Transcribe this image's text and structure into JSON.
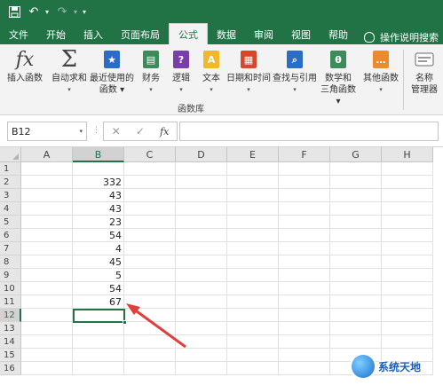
{
  "quick_access": {
    "save_icon": "save-icon",
    "undo_icon": "undo-icon",
    "redo_icon": "redo-icon",
    "customize_icon": "customize-icon"
  },
  "tabs": [
    "文件",
    "开始",
    "插入",
    "页面布局",
    "公式",
    "数据",
    "审阅",
    "视图",
    "帮助"
  ],
  "active_tab": "公式",
  "tell_me": "操作说明搜索",
  "ribbon": {
    "buttons": [
      {
        "line1": "插入函数",
        "line2": "",
        "icon": "fx-icon"
      },
      {
        "line1": "自动求和",
        "line2": "▾",
        "icon": "sigma-icon"
      },
      {
        "line1": "最近使用的",
        "line2": "函数 ▾",
        "icon": "star-icon"
      },
      {
        "line1": "财务",
        "line2": "▾",
        "icon": "book-icon"
      },
      {
        "line1": "逻辑",
        "line2": "▾",
        "icon": "question-icon"
      },
      {
        "line1": "文本",
        "line2": "▾",
        "icon": "text-icon"
      },
      {
        "line1": "日期和时间",
        "line2": "▾",
        "icon": "calendar-icon"
      },
      {
        "line1": "查找与引用",
        "line2": "▾",
        "icon": "magnifier-icon"
      },
      {
        "line1": "数学和",
        "line2": "三角函数 ▾",
        "icon": "theta-icon"
      },
      {
        "line1": "其他函数",
        "line2": "▾",
        "icon": "more-icon"
      },
      {
        "line1": "名称",
        "line2": "管理器",
        "icon": "name-manager-icon"
      }
    ],
    "group_label": "函数库"
  },
  "formula_bar": {
    "name_box": "B12",
    "cancel": "✕",
    "enter": "✓",
    "fx": "fx",
    "value": ""
  },
  "columns": [
    "A",
    "B",
    "C",
    "D",
    "E",
    "F",
    "G",
    "H"
  ],
  "rows": [
    "1",
    "2",
    "3",
    "4",
    "5",
    "6",
    "7",
    "8",
    "9",
    "10",
    "11",
    "12",
    "13",
    "14",
    "15",
    "16"
  ],
  "cells_B": [
    "",
    "332",
    "43",
    "43",
    "23",
    "54",
    "4",
    "45",
    "5",
    "54",
    "67",
    "",
    "",
    "",
    "",
    ""
  ],
  "selected_cell": "B12",
  "watermark": "系统天地",
  "colors": {
    "accent": "#217346",
    "arrow": "#e0403a"
  }
}
